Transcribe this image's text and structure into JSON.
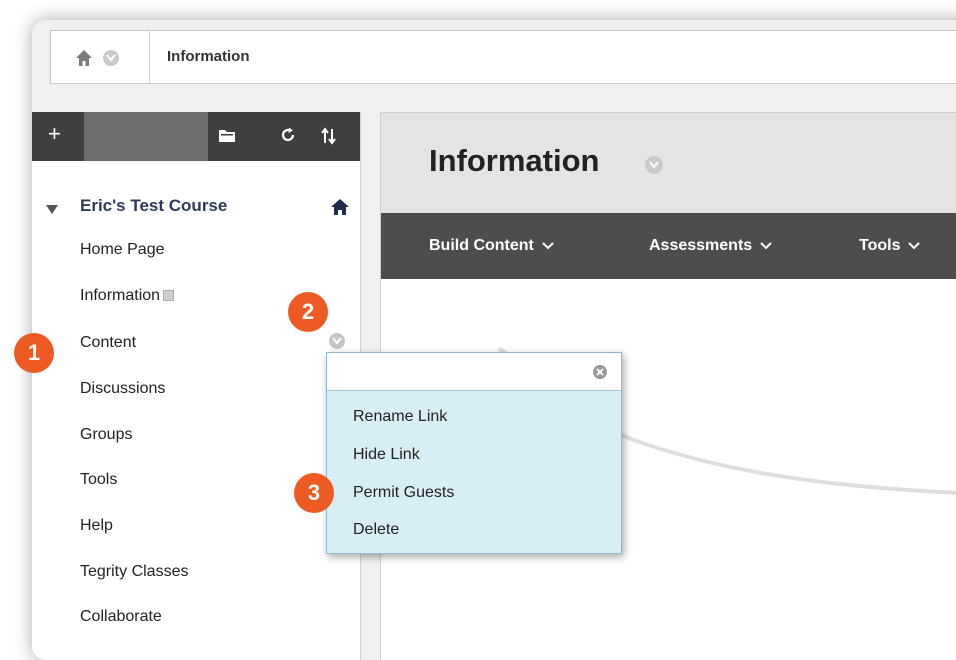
{
  "breadcrumb": {
    "title": "Information"
  },
  "course": {
    "name": "Eric's Test Course"
  },
  "menu": {
    "items": [
      "Home Page",
      "Information",
      "Content",
      "Discussions",
      "Groups",
      "Tools",
      "Help",
      "Tegrity Classes",
      "Collaborate"
    ]
  },
  "main": {
    "title": "Information",
    "actions": [
      "Build Content",
      "Assessments",
      "Tools"
    ]
  },
  "popup": {
    "items": [
      "Rename Link",
      "Hide Link",
      "Permit Guests",
      "Delete"
    ]
  },
  "callouts": [
    "1",
    "2",
    "3"
  ],
  "icons": {
    "home": "home-icon",
    "chevron": "chevron-down-icon",
    "plus": "plus-icon",
    "folder": "folder-icon",
    "refresh": "refresh-icon",
    "sort": "sort-icon",
    "close": "close-icon"
  },
  "colors": {
    "toolbar": "#3f3f3f",
    "action_bar": "#4d4d4d",
    "popup": "#d8eef6",
    "callout": "#ee5a23",
    "course_name": "#2d3b5a"
  }
}
